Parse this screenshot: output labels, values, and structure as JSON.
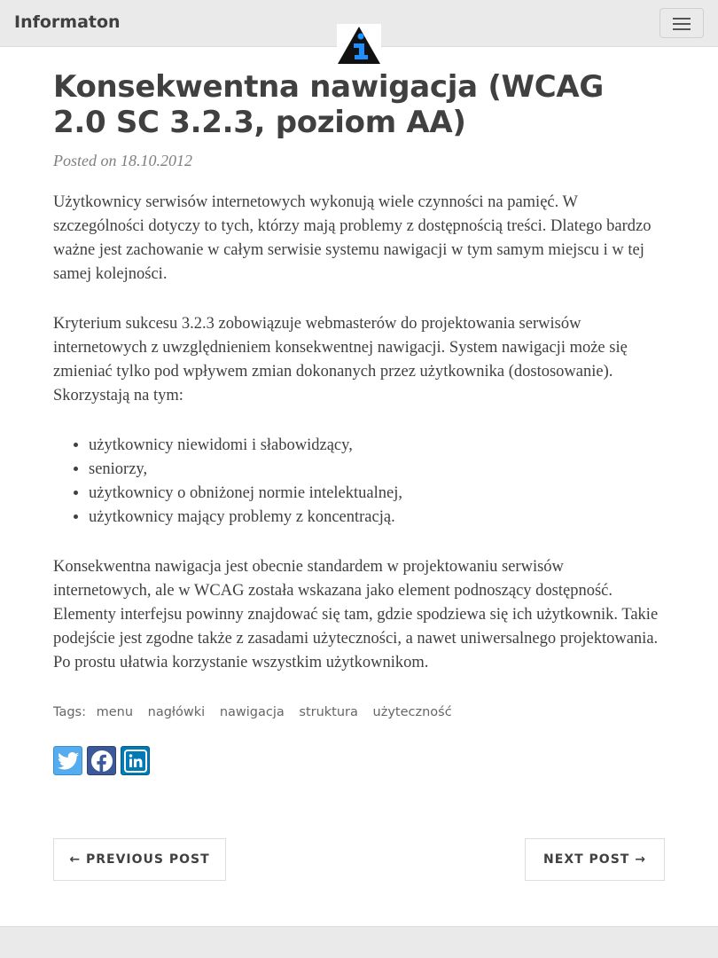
{
  "navbar": {
    "brand": "Informaton",
    "menu_icon": "hamburger-icon",
    "logo_icon": "info-triangle-logo-icon"
  },
  "post": {
    "title": "Konsekwentna nawigacja (WCAG 2.0 SC 3.2.3, poziom AA)",
    "meta": "Posted on 18.10.2012",
    "paragraphs": [
      "Użytkownicy serwisów internetowych wykonują wiele czynności na pamięć. W szczególności dotyczy to tych, którzy mają problemy z dostępnością treści. Dlatego bardzo ważne jest zachowanie w całym serwisie systemu nawigacji w tym samym miejscu i w tej samej kolejności.",
      "Kryterium sukcesu 3.2.3 zobowiązuje webmasterów do projektowania serwisów internetowych z uwzględnieniem konsekwentnej nawigacji. System nawigacji może się zmieniać tylko pod wpływem zmian dokonanych przez użytkownika (dostosowanie). Skorzystają na tym:",
      "Konsekwentna nawigacja jest obecnie standardem w projektowaniu serwisów internetowych, ale w WCAG została wskazana jako element podnoszący dostępność. Elementy interfejsu powinny znajdować się tam, gdzie spodziewa się ich użytkownik. Takie podejście jest zgodne także z zasadami użyteczności, a nawet uniwersalnego projektowania. Po prostu ułatwia korzystanie wszystkim użytkownikom."
    ],
    "list": [
      "użytkownicy niewidomi i słabowidzący,",
      "seniorzy,",
      "użytkownicy o obniżonej normie intelektualnej,",
      "użytkownicy mający problemy z koncentracją."
    ]
  },
  "tags": {
    "label": "Tags:",
    "items": [
      "menu",
      "nagłówki",
      "nawigacja",
      "struktura",
      "użyteczność"
    ]
  },
  "share": {
    "icons": [
      "twitter-icon",
      "facebook-icon",
      "linkedin-icon"
    ],
    "colors": {
      "twitter": "#55acee",
      "facebook": "#3b5998",
      "linkedin": "#007bb6"
    }
  },
  "pager": {
    "previous": "← PREVIOUS POST",
    "next": "NEXT POST →"
  }
}
